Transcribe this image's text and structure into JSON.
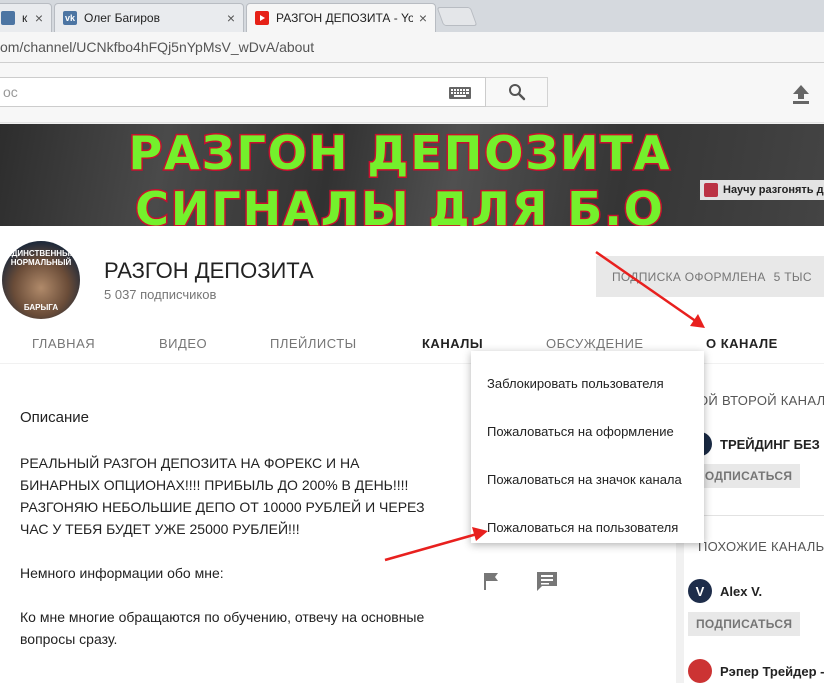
{
  "browser": {
    "tabs": [
      {
        "label": "к в",
        "favicon_color": "#4c75a3"
      },
      {
        "label": "Олег Багиров",
        "favicon_color": "#4c75a3"
      },
      {
        "label": "РАЗГОН ДЕПОЗИТА - Yo",
        "favicon_color": "#e62117"
      }
    ],
    "close_glyph": "×",
    "url": "om/channel/UCNkfbo4hFQj5nYpMsV_wDvA/about"
  },
  "masthead": {
    "search_placeholder": "ос",
    "search_icon": "search-icon",
    "keyboard_icon": "keyboard-icon",
    "upload_icon": "upload-icon"
  },
  "banner": {
    "line1": "РАЗГОН ДЕПОЗИТА",
    "line2": "СИГНАЛЫ ДЛЯ Б.О",
    "link_text": "Научу разгонять де"
  },
  "channel": {
    "avatar_text_top1": "ЕДИНСТВЕННЫЙ",
    "avatar_text_top2": "НОРМАЛЬНЫЙ",
    "avatar_text_bottom": "БАРЫГА",
    "name": "РАЗГОН ДЕПОЗИТА",
    "subscribers": "5 037 подписчиков",
    "subscribed_label": "ПОДПИСКА ОФОРМЛЕНА",
    "subscribed_count": "5 ТЫС"
  },
  "nav": {
    "tabs": [
      "ГЛАВНАЯ",
      "ВИДЕО",
      "ПЛЕЙЛИСТЫ",
      "КАНАЛЫ",
      "ОБСУЖДЕНИЕ",
      "О КАНАЛЕ"
    ],
    "active": "О КАНАЛЕ"
  },
  "about": {
    "title": "Описание",
    "paragraphs": [
      "РЕАЛЬНЫЙ РАЗГОН ДЕПОЗИТА НА ФОРЕКС И НА БИНАРНЫХ ОПЦИОНАХ!!!! ПРИБЫЛЬ ДО 200% В ДЕНЬ!!!!  РАЗГОНЯЮ НЕБОЛЬШИЕ ДЕПО ОТ 10000 РУБЛЕЙ И ЧЕРЕЗ ЧАС У ТЕБЯ БУДЕТ УЖЕ 25000 РУБЛЕЙ!!!",
      "Немного информации обо мне:",
      "Ко мне многие обращаются по обучению, отвечу на основные вопросы сразу."
    ],
    "flag_icon": "flag-icon",
    "message_icon": "message-icon"
  },
  "menu": {
    "items": [
      "Заблокировать пользователя",
      "Пожаловаться на оформление",
      "Пожаловаться на значок канала",
      "Пожаловаться на пользователя"
    ]
  },
  "sidebar": {
    "section1_title": "ОЙ ВТОРОЙ КАНАЛ",
    "section1_channel": "ТРЕЙДИНГ БЕЗ",
    "section1_sub": "ПОДПИСАТЬСЯ",
    "section2_title": "ПОХОЖИЕ КАНАЛЫ",
    "section2_channels": [
      {
        "name": "Alex V.",
        "avatar_letter": "V",
        "sub": "ПОДПИСАТЬСЯ"
      },
      {
        "name": "Рэпер Трейдер -",
        "avatar_letter": "",
        "sub": ""
      }
    ]
  },
  "annotations": {
    "arrow_color": "#e8201e"
  }
}
